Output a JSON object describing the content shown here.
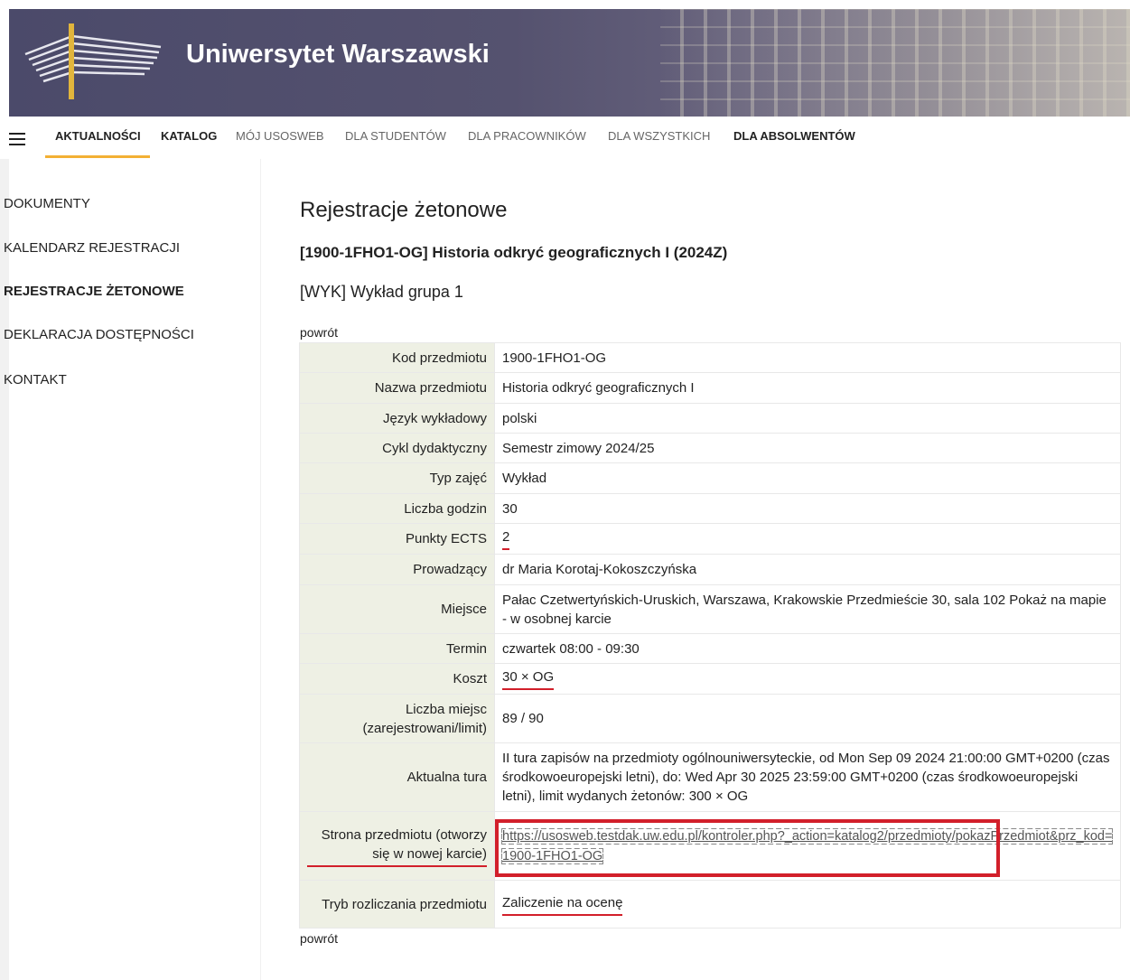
{
  "header": {
    "title": "Uniwersytet Warszawski"
  },
  "nav": {
    "items": [
      {
        "label": "AKTUALNOŚCI",
        "style": "bold"
      },
      {
        "label": "KATALOG",
        "style": "bold"
      },
      {
        "label": "MÓJ USOSWEB",
        "style": "muted"
      },
      {
        "label": "DLA STUDENTÓW",
        "style": "muted"
      },
      {
        "label": "DLA PRACOWNIKÓW",
        "style": "muted"
      },
      {
        "label": "DLA WSZYSTKICH",
        "style": "muted"
      },
      {
        "label": "DLA ABSOLWENTÓW",
        "style": "bold"
      }
    ],
    "active_accent": "#f3b034"
  },
  "sidebar": {
    "items": [
      {
        "label": "DOKUMENTY"
      },
      {
        "label": "KALENDARZ REJESTRACJI"
      },
      {
        "label": "REJESTRACJE ŻETONOWE",
        "active": true
      },
      {
        "label": "DEKLARACJA DOSTĘPNOŚCI"
      },
      {
        "label": "KONTAKT"
      }
    ]
  },
  "main": {
    "title": "Rejestracje żetonowe",
    "course_heading": "[1900-1FHO1-OG] Historia odkryć geograficznych I (2024Z)",
    "group_heading": "[WYK] Wykład grupa 1",
    "back_label": "powrót",
    "rows": [
      {
        "key": "Kod przedmiotu",
        "value": "1900-1FHO1-OG"
      },
      {
        "key": "Nazwa przedmiotu",
        "value": "Historia odkryć geograficznych I"
      },
      {
        "key": "Język wykładowy",
        "value": "polski"
      },
      {
        "key": "Cykl dydaktyczny",
        "value": "Semestr zimowy 2024/25"
      },
      {
        "key": "Typ zajęć",
        "value": "Wykład"
      },
      {
        "key": "Liczba godzin",
        "value": "30"
      },
      {
        "key": "Punkty ECTS",
        "value": "2"
      },
      {
        "key": "Prowadzący",
        "value": "dr Maria Korotaj-Kokoszczyńska"
      },
      {
        "key": "Miejsce",
        "value": "Pałac Czetwertyńskich-Uruskich, Warszawa, Krakowskie Przedmieście 30, sala 102 Pokaż na mapie - w osobnej karcie"
      },
      {
        "key": "Termin",
        "value": "czwartek 08:00 - 09:30"
      },
      {
        "key": "Koszt",
        "value": "30 × OG"
      },
      {
        "key": "Liczba miejsc (zarejestrowani/limit)",
        "value": "89 / 90"
      },
      {
        "key": "Aktualna tura",
        "value": "II tura zapisów na przedmioty ogólnouniwersyteckie, od Mon Sep 09 2024 21:00:00 GMT+0200 (czas środkowoeuropejski letni), do: Wed Apr 30 2025 23:59:00 GMT+0200 (czas środkowoeuropejski letni), limit wydanych żetonów: 300 × OG"
      },
      {
        "key": "Strona przedmiotu (otworzy się w nowej karcie)",
        "value": "https://usosweb.testdak.uw.edu.pl/kontroler.php?_action=katalog2/przedmioty/pokazPrzedmiot&prz_kod=1900-1FHO1-OG"
      },
      {
        "key": "Tryb rozliczania przedmiotu",
        "value": "Zaliczenie na ocenę"
      }
    ]
  },
  "colors": {
    "banner": "#4b4a6a",
    "highlight": "#d21f2a",
    "key_cell": "#eef0e4"
  }
}
